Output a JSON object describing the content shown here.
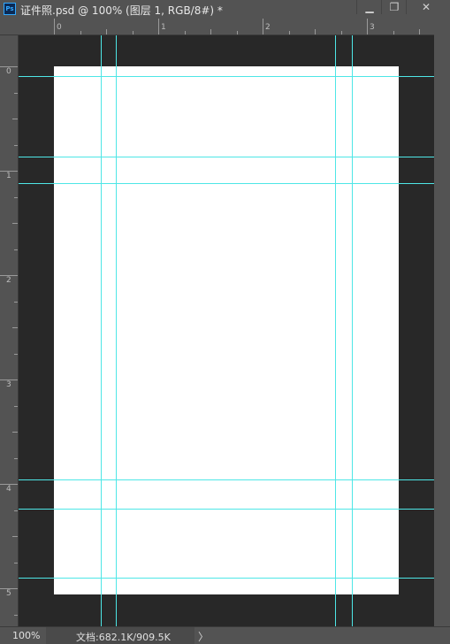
{
  "window": {
    "title": "证件照.psd @ 100% (图层 1, RGB/8#) *",
    "app_icon": "Ps",
    "buttons": {
      "minimize": "▁",
      "maximize": "❐",
      "close": "✕"
    }
  },
  "ruler": {
    "top_labels": [
      "0",
      "1",
      "2",
      "3"
    ],
    "left_labels": [
      "0",
      "1",
      "2",
      "3",
      "4",
      "5"
    ]
  },
  "guides_color": "#4ee6e6",
  "status": {
    "zoom": "100%",
    "doc_size": "文档:682.1K/909.5K",
    "arrow": "〉"
  }
}
